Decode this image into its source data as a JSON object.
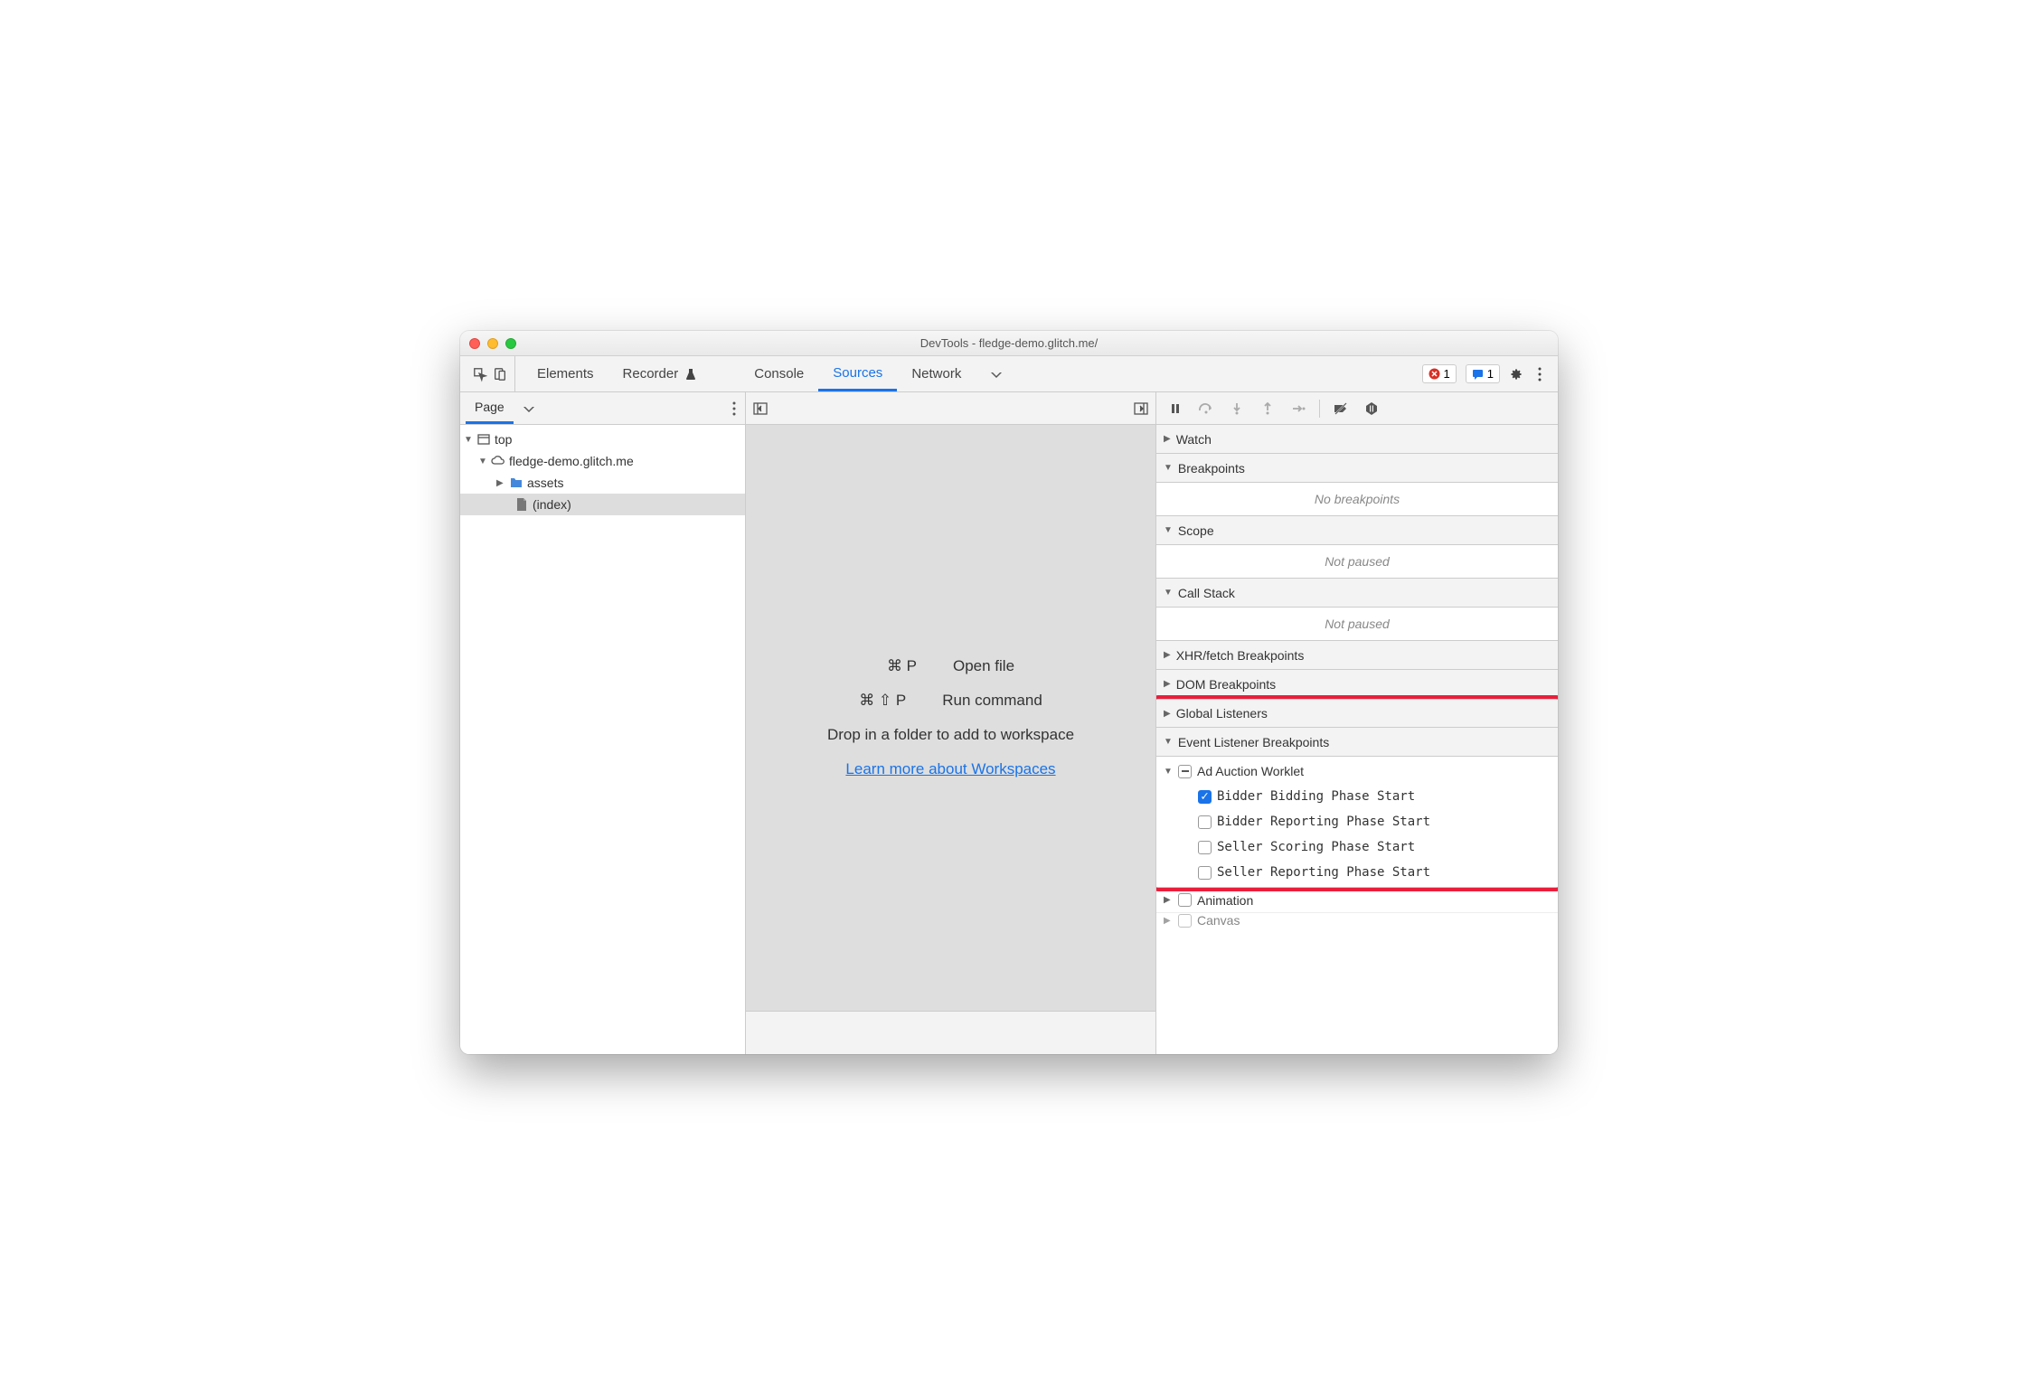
{
  "title": "DevTools - fledge-demo.glitch.me/",
  "toolbar": {
    "tabs": [
      "Elements",
      "Recorder",
      "Console",
      "Sources",
      "Network"
    ],
    "active_tab": "Sources",
    "error_count": "1",
    "msg_count": "1"
  },
  "navigator": {
    "tabs": [
      "Page"
    ],
    "tree": {
      "top": "top",
      "domain": "fledge-demo.glitch.me",
      "folder": "assets",
      "file": "(index)"
    }
  },
  "editor": {
    "hints": {
      "openfile_shortcut": "⌘ P",
      "openfile_label": "Open file",
      "runcmd_shortcut": "⌘ ⇧ P",
      "runcmd_label": "Run command",
      "drop_text": "Drop in a folder to add to workspace",
      "learn_link": "Learn more about Workspaces"
    }
  },
  "debugger": {
    "sections": {
      "watch": "Watch",
      "breakpoints": "Breakpoints",
      "breakpoints_empty": "No breakpoints",
      "scope": "Scope",
      "scope_empty": "Not paused",
      "callstack": "Call Stack",
      "callstack_empty": "Not paused",
      "xhr": "XHR/fetch Breakpoints",
      "dom": "DOM Breakpoints",
      "global": "Global Listeners",
      "elb": "Event Listener Breakpoints",
      "ad_worklet": {
        "title": "Ad Auction Worklet",
        "items": [
          {
            "label": "Bidder Bidding Phase Start",
            "checked": true
          },
          {
            "label": "Bidder Reporting Phase Start",
            "checked": false
          },
          {
            "label": "Seller Scoring Phase Start",
            "checked": false
          },
          {
            "label": "Seller Reporting Phase Start",
            "checked": false
          }
        ]
      },
      "animation": "Animation",
      "canvas": "Canvas"
    }
  }
}
